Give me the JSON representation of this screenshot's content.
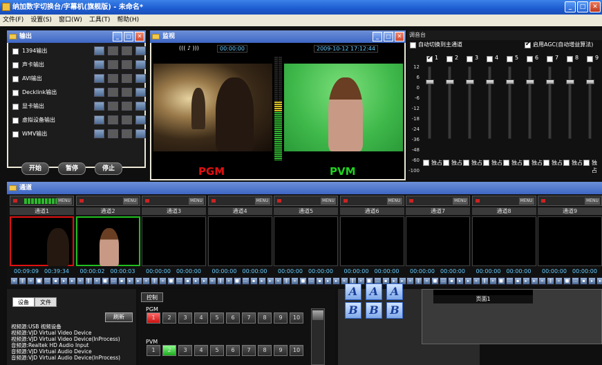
{
  "app": {
    "title": "纳加数字切换台/字幕机(旗舰版) - 未命名*"
  },
  "menu": [
    "文件(F)",
    "设置(S)",
    "窗口(W)",
    "工具(T)",
    "帮助(H)"
  ],
  "output": {
    "title": "输出",
    "rows": [
      {
        "label": "1394输出",
        "checked": false
      },
      {
        "label": "声卡输出",
        "checked": false
      },
      {
        "label": "AVI输出",
        "checked": false
      },
      {
        "label": "Decklink输出",
        "checked": false
      },
      {
        "label": "显卡输出",
        "checked": false
      },
      {
        "label": "虚拟设备输出",
        "checked": false
      },
      {
        "label": "WMV输出",
        "checked": false
      }
    ],
    "buttons": {
      "start": "开始",
      "pause": "暂停",
      "stop": "停止"
    }
  },
  "monitor": {
    "title": "监视",
    "audio_indicator": "((( ♪ )))",
    "timecode": "00:00:00",
    "datetime": "2009-10-12 17:12:44",
    "pgm_label": "PGM",
    "pvm_label": "PVM"
  },
  "mixer": {
    "title": "调音台",
    "auto_switch_label": "自动切换到主通道",
    "auto_switch_checked": false,
    "agc_label": "启用AGC(自动增益算法)",
    "agc_checked": true,
    "channels": [
      "1",
      "2",
      "3",
      "4",
      "5",
      "6",
      "7",
      "8",
      "9"
    ],
    "channel_checked": [
      true,
      false,
      false,
      false,
      false,
      false,
      false,
      false,
      false
    ],
    "scale": [
      "12",
      "6",
      "0",
      "-6",
      "-12",
      "-18",
      "-24",
      "-36",
      "-48",
      "-60",
      "-100"
    ],
    "solo_label": "独占"
  },
  "channels": {
    "title": "通道",
    "menu_label": "MENU",
    "items": [
      {
        "name": "通道1",
        "tc_in": "00:09:09",
        "tc_out": "00:39:34",
        "active": "pgm"
      },
      {
        "name": "通道2",
        "tc_in": "00:00:02",
        "tc_out": "00:00:03",
        "active": "pvm"
      },
      {
        "name": "通道3",
        "tc_in": "00:00:00",
        "tc_out": "00:00:00",
        "active": ""
      },
      {
        "name": "通道4",
        "tc_in": "00:00:00",
        "tc_out": "00:00:00",
        "active": ""
      },
      {
        "name": "通道5",
        "tc_in": "00:00:00",
        "tc_out": "00:00:00",
        "active": ""
      },
      {
        "name": "通道6",
        "tc_in": "00:00:00",
        "tc_out": "00:00:00",
        "active": ""
      },
      {
        "name": "通道7",
        "tc_in": "00:00:00",
        "tc_out": "00:00:00",
        "active": ""
      },
      {
        "name": "通道8",
        "tc_in": "00:00:00",
        "tc_out": "00:00:00",
        "active": ""
      },
      {
        "name": "通道9",
        "tc_in": "00:00:00",
        "tc_out": "00:00:00",
        "active": ""
      }
    ]
  },
  "devices": {
    "tabs": [
      "设备",
      "文件"
    ],
    "refresh": "刷新",
    "list": [
      "视频源:USB 视频设备",
      "视频源:VJD Virtual Video Device",
      "视频源:VJD Virtual Video Device(InProcess)",
      "音频源:Realtek HD Audio Input",
      "音频源:VJD Virtual Audio Device",
      "音频源:VJD Virtual Audio Device(InProcess)"
    ]
  },
  "control": {
    "tab": "控制",
    "pgm_label": "PGM",
    "pvm_label": "PVM",
    "numbers": [
      "1",
      "2",
      "3",
      "4",
      "5",
      "6",
      "7",
      "8",
      "9",
      "10"
    ],
    "pgm_selected": 1,
    "pvm_selected": 2
  },
  "effects": {
    "letters": [
      "A",
      "A",
      "A",
      "B",
      "B",
      "B"
    ]
  },
  "page": {
    "label": "页面1"
  }
}
